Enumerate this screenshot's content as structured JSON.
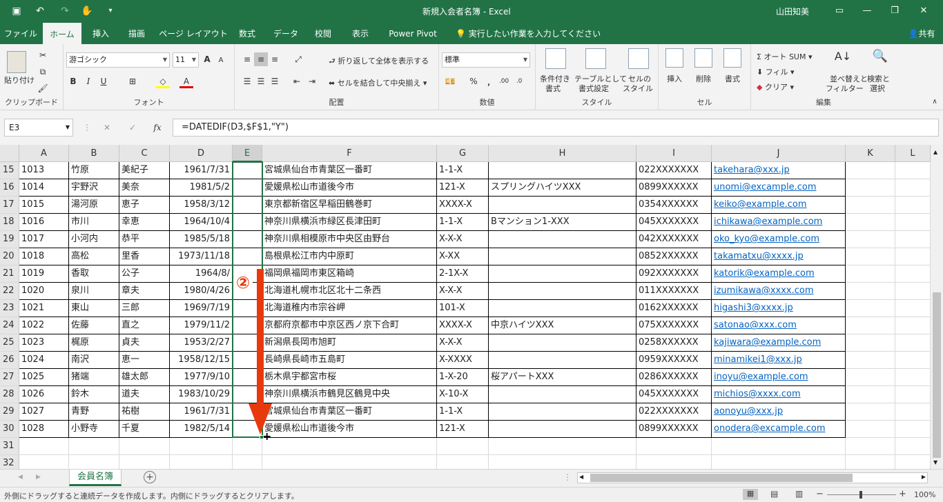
{
  "title": {
    "document": "新規入会者名簿 - Excel",
    "user": "山田知美"
  },
  "tabs": [
    "ファイル",
    "ホーム",
    "挿入",
    "描画",
    "ページ レイアウト",
    "数式",
    "データ",
    "校閲",
    "表示",
    "Power Pivot"
  ],
  "tellme": "実行したい作業を入力してください",
  "share": "共有",
  "ribbon": {
    "clipboard": {
      "paste": "貼り付け",
      "label": "クリップボード"
    },
    "font": {
      "name": "游ゴシック",
      "size": "11",
      "label": "フォント"
    },
    "align": {
      "wrap": "折り返して全体を表示する",
      "merge": "セルを結合して中央揃え",
      "label": "配置"
    },
    "number": {
      "format": "標準",
      "label": "数値"
    },
    "styles": {
      "cond": "条件付き",
      "cond2": "書式",
      "table": "テーブルとして",
      "table2": "書式設定",
      "cell": "セルの",
      "cell2": "スタイル",
      "label": "スタイル"
    },
    "cells": {
      "insert": "挿入",
      "delete": "削除",
      "format": "書式",
      "label": "セル"
    },
    "edit": {
      "autosum": "オート SUM",
      "fill": "フィル",
      "clear": "クリア",
      "sort": "並べ替えと",
      "sort2": "フィルター",
      "find": "検索と",
      "find2": "選択",
      "label": "編集"
    }
  },
  "formula": {
    "namebox": "E3",
    "formula": "=DATEDIF(D3,$F$1,\"Y\")"
  },
  "columns": [
    "A",
    "B",
    "C",
    "D",
    "E",
    "F",
    "G",
    "H",
    "I",
    "J",
    "K",
    "L"
  ],
  "rows": [
    {
      "n": "15",
      "a": "1013",
      "b": "竹原",
      "c": "美紀子",
      "d": "1961/7/31",
      "f": "宮城県仙台市青葉区一番町",
      "g": "1-1-X",
      "h": "",
      "i": "022XXXXXXX",
      "j": "takehara@xxx.jp"
    },
    {
      "n": "16",
      "a": "1014",
      "b": "宇野沢",
      "c": "美奈",
      "d": "1981/5/2",
      "f": "愛媛県松山市道後今市",
      "g": "121-X",
      "h": "スプリングハイツXXX",
      "i": "0899XXXXXX",
      "j": "unomi@excample.com"
    },
    {
      "n": "17",
      "a": "1015",
      "b": "湯河原",
      "c": "恵子",
      "d": "1958/3/12",
      "f": "東京都新宿区早稲田鶴巻町",
      "g": "XXXX-X",
      "h": "",
      "i": "0354XXXXXX",
      "j": "keiko@example.com"
    },
    {
      "n": "18",
      "a": "1016",
      "b": "市川",
      "c": "幸恵",
      "d": "1964/10/4",
      "f": "神奈川県横浜市緑区長津田町",
      "g": "1-1-X",
      "h": "Bマンション1-XXX",
      "i": "045XXXXXXX",
      "j": "ichikawa@example.com"
    },
    {
      "n": "19",
      "a": "1017",
      "b": "小河内",
      "c": "恭平",
      "d": "1985/5/18",
      "f": "神奈川県相模原市中央区由野台",
      "g": "X-X-X",
      "h": "",
      "i": "042XXXXXXX",
      "j": "oko_kyo@example.com"
    },
    {
      "n": "20",
      "a": "1018",
      "b": "高松",
      "c": "里香",
      "d": "1973/11/18",
      "f": "島根県松江市内中原町",
      "g": "X-XX",
      "h": "",
      "i": "0852XXXXXX",
      "j": "takamatxu@xxxx.jp"
    },
    {
      "n": "21",
      "a": "1019",
      "b": "香取",
      "c": "公子",
      "d": "1964/8/",
      "f": "福岡県福岡市東区箱崎",
      "g": "2-1X-X",
      "h": "",
      "i": "092XXXXXXX",
      "j": "katorik@example.com"
    },
    {
      "n": "22",
      "a": "1020",
      "b": "泉川",
      "c": "章夫",
      "d": "1980/4/26",
      "f": "北海道札幌市北区北十二条西",
      "g": "X-X-X",
      "h": "",
      "i": "011XXXXXXX",
      "j": "izumikawa@xxxx.com"
    },
    {
      "n": "23",
      "a": "1021",
      "b": "東山",
      "c": "三郎",
      "d": "1969/7/19",
      "f": "北海道稚内市宗谷岬",
      "g": "101-X",
      "h": "",
      "i": "0162XXXXXX",
      "j": "higashi3@xxxx.jp"
    },
    {
      "n": "24",
      "a": "1022",
      "b": "佐藤",
      "c": "直之",
      "d": "1979/11/2",
      "f": "京都府京都市中京区西ノ京下合町",
      "g": "XXXX-X",
      "h": "中京ハイツXXX",
      "i": "075XXXXXXX",
      "j": "satonao@xxx.com"
    },
    {
      "n": "25",
      "a": "1023",
      "b": "梶原",
      "c": "貞夫",
      "d": "1953/2/27",
      "f": "新潟県長岡市旭町",
      "g": "X-X-X",
      "h": "",
      "i": "0258XXXXXX",
      "j": "kajiwara@example.com"
    },
    {
      "n": "26",
      "a": "1024",
      "b": "南沢",
      "c": "恵一",
      "d": "1958/12/15",
      "f": "長崎県長崎市五島町",
      "g": "X-XXXX",
      "h": "",
      "i": "0959XXXXXX",
      "j": "minamikei1@xxx.jp"
    },
    {
      "n": "27",
      "a": "1025",
      "b": "猪端",
      "c": "雄太郎",
      "d": "1977/9/10",
      "f": "栃木県宇都宮市桜",
      "g": "1-X-20",
      "h": "桜アパートXXX",
      "i": "0286XXXXXX",
      "j": "inoyu@example.com"
    },
    {
      "n": "28",
      "a": "1026",
      "b": "鈴木",
      "c": "道夫",
      "d": "1983/10/29",
      "f": "神奈川県横浜市鶴見区鶴見中央",
      "g": "X-10-X",
      "h": "",
      "i": "045XXXXXXX",
      "j": "michios@xxxx.com"
    },
    {
      "n": "29",
      "a": "1027",
      "b": "青野",
      "c": "祐樹",
      "d": "1961/7/31",
      "f": "宮城県仙台市青葉区一番町",
      "g": "1-1-X",
      "h": "",
      "i": "022XXXXXXX",
      "j": "aonoyu@xxx.jp"
    },
    {
      "n": "30",
      "a": "1028",
      "b": "小野寺",
      "c": "千夏",
      "d": "1982/5/14",
      "f": "愛媛県松山市道後今市",
      "g": "121-X",
      "h": "",
      "i": "0899XXXXXX",
      "j": "onodera@excample.com"
    }
  ],
  "empty_rows": [
    "31",
    "32"
  ],
  "sheet": {
    "name": "会員名簿"
  },
  "status": {
    "message": "外側にドラッグすると連続データを作成します。内側にドラッグするとクリアします。",
    "zoom": "100%"
  },
  "annotation": {
    "step": "②",
    "color": "#e8380d"
  }
}
